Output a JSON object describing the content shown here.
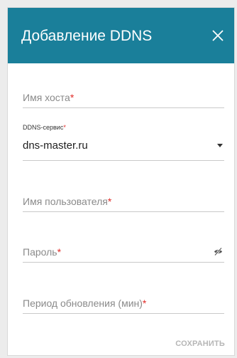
{
  "dialog": {
    "title": "Добавление DDNS",
    "close_icon": "close-icon"
  },
  "form": {
    "hostname": {
      "placeholder": "Имя хоста",
      "required_mark": "*"
    },
    "ddns_service": {
      "label": "DDNS-сервис",
      "required_mark": "*",
      "value": "dns-master.ru",
      "icon": "chevron-down-icon"
    },
    "username": {
      "placeholder": "Имя пользователя",
      "required_mark": "*"
    },
    "password": {
      "placeholder": "Пароль",
      "required_mark": "*",
      "icon": "eye-slash-icon"
    },
    "update_period": {
      "placeholder": "Период обновления (мин)",
      "required_mark": "*"
    }
  },
  "actions": {
    "save_label": "СОХРАНИТЬ"
  },
  "colors": {
    "header_bg": "#1a7f9a",
    "required": "#e02b27",
    "disabled_text": "#b6b6b6"
  }
}
